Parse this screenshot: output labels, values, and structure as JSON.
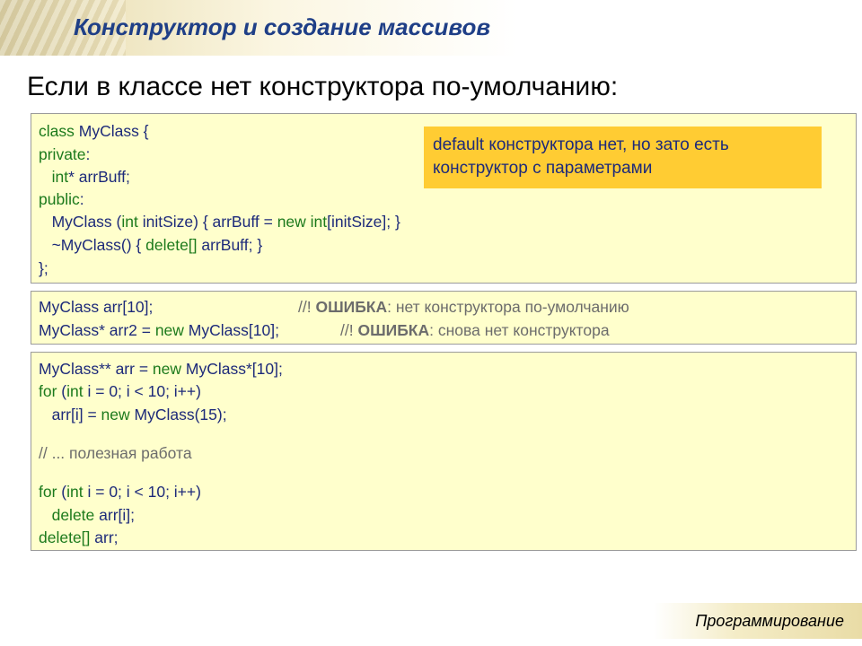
{
  "header": {
    "title": "Конструктор и создание массивов"
  },
  "subtitle": "Если в классе нет конструктора по-умолчанию:",
  "code1": [
    "class MyClass {",
    "private:",
    "   int* arrBuff;",
    "public:",
    "   MyClass (int initSize) { arrBuff = new int[initSize]; }",
    "   ~MyClass() { delete[] arrBuff; }",
    "};"
  ],
  "note": {
    "line1": "default конструктора нет, но зато есть",
    "line2": "конструктор с параметрами"
  },
  "code2": {
    "line1_code": "MyClass arr[10];",
    "line1_comment_prefix": "//! ",
    "line1_error": "ОШИБКА",
    "line1_comment_rest": ": нет конструктора по-умолчанию",
    "line2_code": "MyClass* arr2 = new MyClass[10];",
    "line2_comment_prefix": "//! ",
    "line2_error": "ОШИБКА",
    "line2_comment_rest": ": снова нет конструктора"
  },
  "code3": {
    "l1": "MyClass** arr = new MyClass*[10];",
    "l2": "for (int i = 0; i < 10; i++)",
    "l3": "   arr[i] = new MyClass(15);",
    "l4": "// ... полезная работа",
    "l5": "for (int i = 0; i < 10; i++)",
    "l6": "   delete arr[i];",
    "l7": "delete[] arr;"
  },
  "footer": {
    "label": "Программирование"
  }
}
